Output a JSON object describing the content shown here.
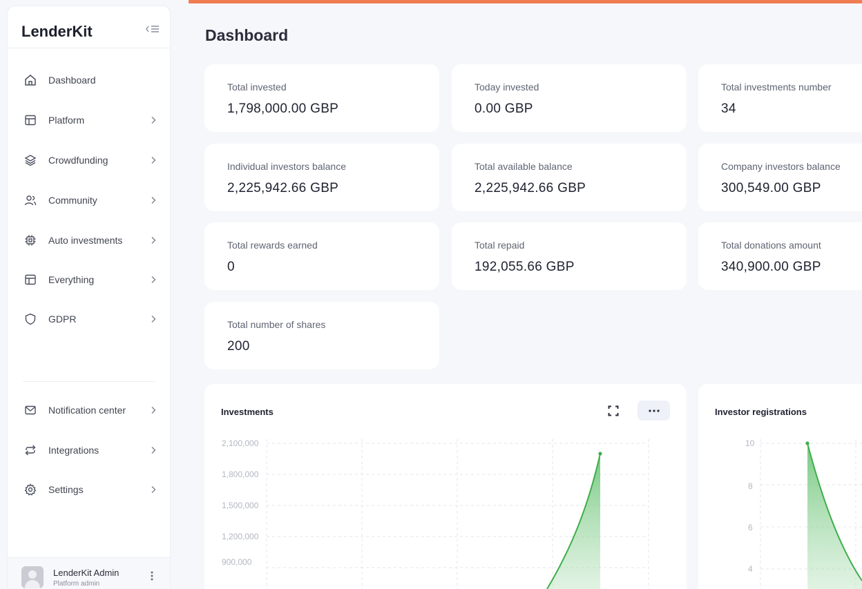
{
  "app": {
    "brand": "LenderKit"
  },
  "sidebar": {
    "items": [
      {
        "label": "Dashboard",
        "icon": "home-icon"
      },
      {
        "label": "Platform",
        "icon": "layout-icon"
      },
      {
        "label": "Crowdfunding",
        "icon": "layers-icon"
      },
      {
        "label": "Community",
        "icon": "users-icon"
      },
      {
        "label": "Auto investments",
        "icon": "cpu-icon"
      },
      {
        "label": "Everything",
        "icon": "layout-icon"
      },
      {
        "label": "GDPR",
        "icon": "shield-icon"
      }
    ],
    "bottom_items": [
      {
        "label": "Notification center",
        "icon": "mail-icon"
      },
      {
        "label": "Integrations",
        "icon": "repeat-icon"
      },
      {
        "label": "Settings",
        "icon": "gear-icon"
      }
    ],
    "user": {
      "name": "LenderKit Admin",
      "role": "Platform admin"
    }
  },
  "main": {
    "title": "Dashboard",
    "stats": [
      {
        "label": "Total invested",
        "value": "1,798,000.00 GBP"
      },
      {
        "label": "Today invested",
        "value": "0.00 GBP"
      },
      {
        "label": "Total investments number",
        "value": "34"
      },
      {
        "label": "Individual investors balance",
        "value": "2,225,942.66 GBP"
      },
      {
        "label": "Total available balance",
        "value": "2,225,942.66 GBP"
      },
      {
        "label": "Company investors balance",
        "value": "300,549.00 GBP"
      },
      {
        "label": "Total rewards earned",
        "value": "0"
      },
      {
        "label": "Total repaid",
        "value": "192,055.66 GBP"
      },
      {
        "label": "Total donations amount",
        "value": "340,900.00 GBP"
      },
      {
        "label": "Total number of shares",
        "value": "200"
      }
    ]
  },
  "colors": {
    "accent": "#f07c52",
    "series": "#3fae4a",
    "fill": "#7cc883"
  },
  "chart_data": [
    {
      "type": "area",
      "title": "Investments",
      "y_ticks": [
        "2,100,000",
        "1,800,000",
        "1,500,000",
        "1,200,000",
        "900,000"
      ],
      "ylim": [
        900000,
        2100000
      ],
      "last_point": 1990000,
      "grid": true
    },
    {
      "type": "area",
      "title": "Investor registrations",
      "y_ticks": [
        "10",
        "8",
        "6",
        "4"
      ],
      "first_point": 10,
      "grid": true
    }
  ]
}
